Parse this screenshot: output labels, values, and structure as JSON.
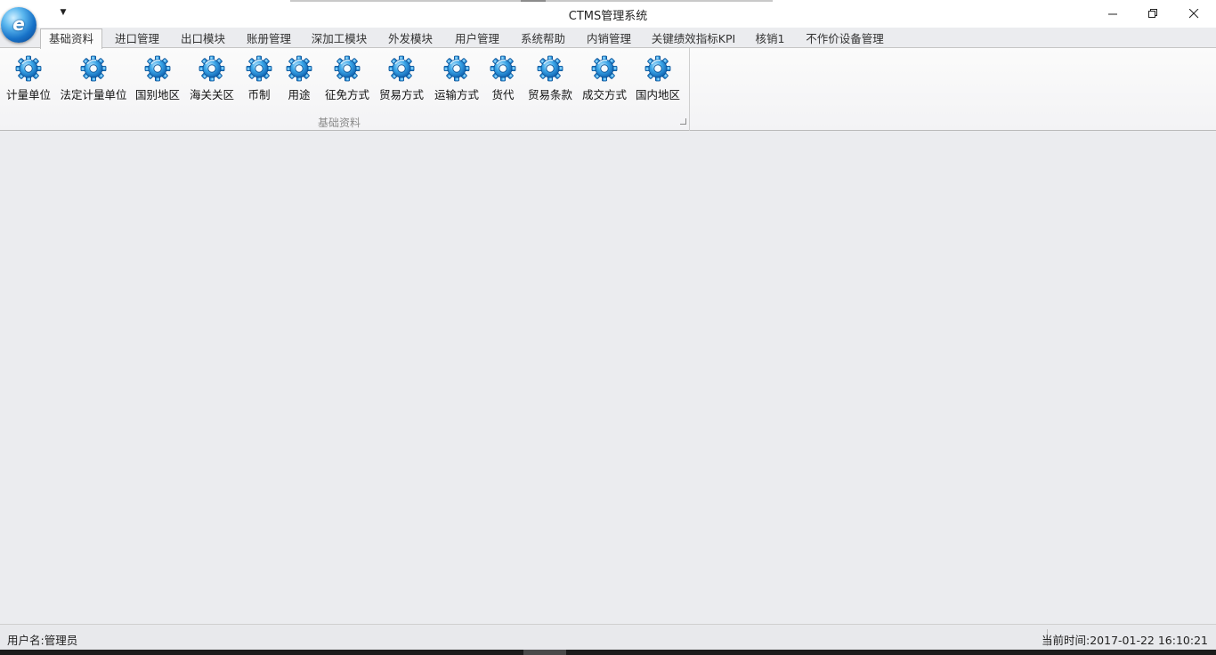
{
  "window": {
    "title": "CTMS管理系统",
    "minimize_icon": "minimize-icon",
    "maximize_icon": "restore-icon",
    "close_icon": "close-icon",
    "qat_icon": "dropdown-arrow-icon"
  },
  "tabs": [
    {
      "label": "基础资料",
      "active": true
    },
    {
      "label": "进口管理"
    },
    {
      "label": "出口模块"
    },
    {
      "label": "账册管理"
    },
    {
      "label": "深加工模块"
    },
    {
      "label": "外发模块"
    },
    {
      "label": "用户管理"
    },
    {
      "label": "系统帮助"
    },
    {
      "label": "内销管理"
    },
    {
      "label": "关键绩效指标KPI"
    },
    {
      "label": "核销1"
    },
    {
      "label": "不作价设备管理"
    }
  ],
  "ribbon": {
    "group_label": "基础资料",
    "buttons": [
      {
        "label": "计量单位",
        "icon": "gear-icon"
      },
      {
        "label": "法定计量单位",
        "icon": "gear-icon"
      },
      {
        "label": "国别地区",
        "icon": "gear-icon"
      },
      {
        "label": "海关关区",
        "icon": "gear-icon"
      },
      {
        "label": "币制",
        "icon": "gear-icon"
      },
      {
        "label": "用途",
        "icon": "gear-icon"
      },
      {
        "label": "征免方式",
        "icon": "gear-icon"
      },
      {
        "label": "贸易方式",
        "icon": "gear-icon"
      },
      {
        "label": "运输方式",
        "icon": "gear-icon"
      },
      {
        "label": "货代",
        "icon": "gear-icon"
      },
      {
        "label": "贸易条款",
        "icon": "gear-icon"
      },
      {
        "label": "成交方式",
        "icon": "gear-icon"
      },
      {
        "label": "国内地区",
        "icon": "gear-icon"
      }
    ]
  },
  "status": {
    "user": "用户名:管理员",
    "time": "当前时间:2017-01-22 16:10:21"
  },
  "colors": {
    "accent": "#1a86d0",
    "gear": "#2f9be0",
    "background": "#ebecef"
  }
}
